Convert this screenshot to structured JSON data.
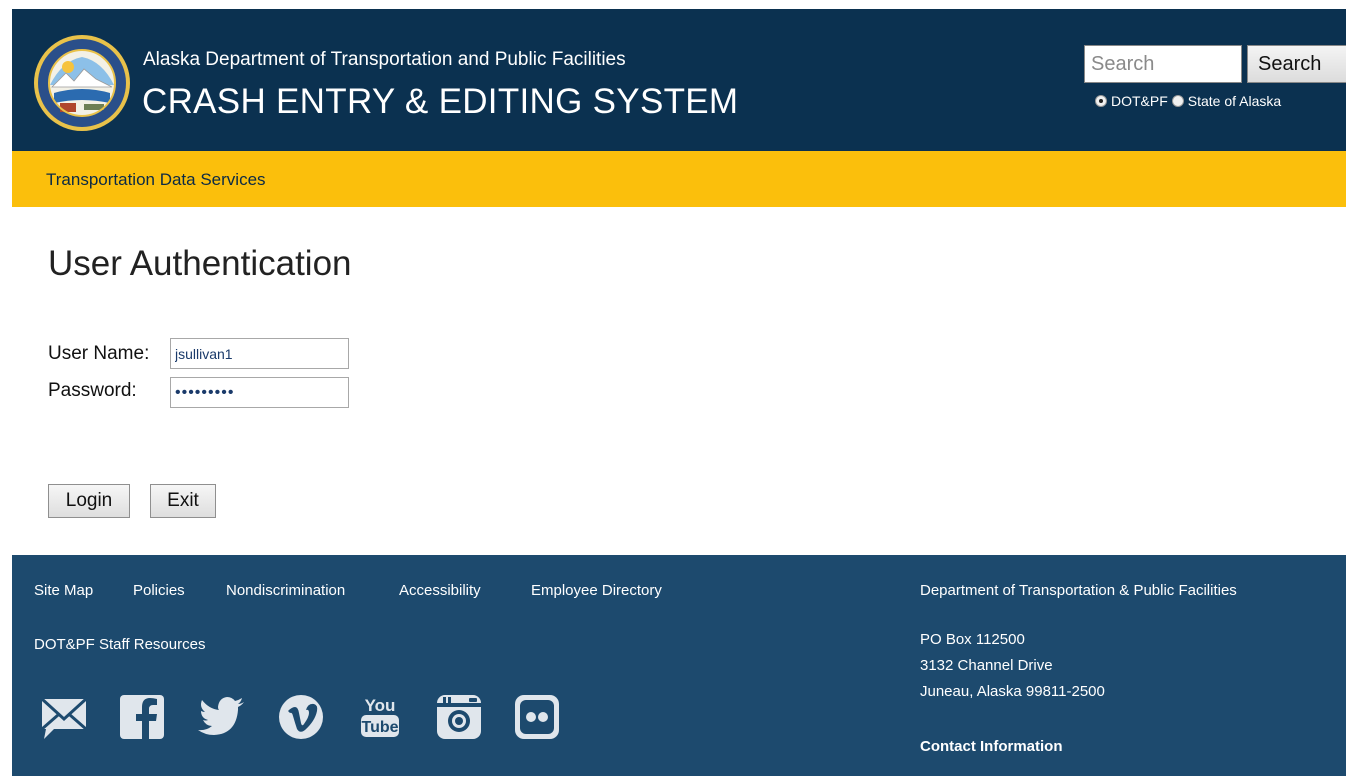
{
  "header": {
    "agency": "Alaska Department of Transportation and Public Facilities",
    "system_title": "CRASH ENTRY & EDITING SYSTEM",
    "search": {
      "placeholder": "Search",
      "button_label": "Search"
    },
    "scope_options": [
      {
        "label": "DOT&PF",
        "selected": true
      },
      {
        "label": "State of Alaska",
        "selected": false
      }
    ]
  },
  "nav": {
    "label": "Transportation Data Services"
  },
  "main": {
    "title": "User Authentication",
    "username_label": "User Name:",
    "username_value": "jsullivan1",
    "password_label": "Password:",
    "password_value": "xxxxxxxxx",
    "login_label": "Login",
    "exit_label": "Exit"
  },
  "footer": {
    "links": [
      "Site Map",
      "Policies",
      "Nondiscrimination",
      "Accessibility",
      "Employee Directory"
    ],
    "staff_resources": "DOT&PF Staff Resources",
    "dept_name": "Department of Transportation & Public Facilities",
    "address": [
      "PO Box 112500",
      "3132 Channel Drive",
      "Juneau, Alaska 99811-2500"
    ],
    "contact": "Contact Information",
    "social_icons": [
      "email-icon",
      "facebook-icon",
      "twitter-icon",
      "vimeo-icon",
      "youtube-icon",
      "instagram-icon",
      "flickr-icon"
    ]
  },
  "colors": {
    "header_bg": "#0b3150",
    "nav_bg": "#fbbf0c",
    "footer_bg": "#1d4a6e"
  }
}
